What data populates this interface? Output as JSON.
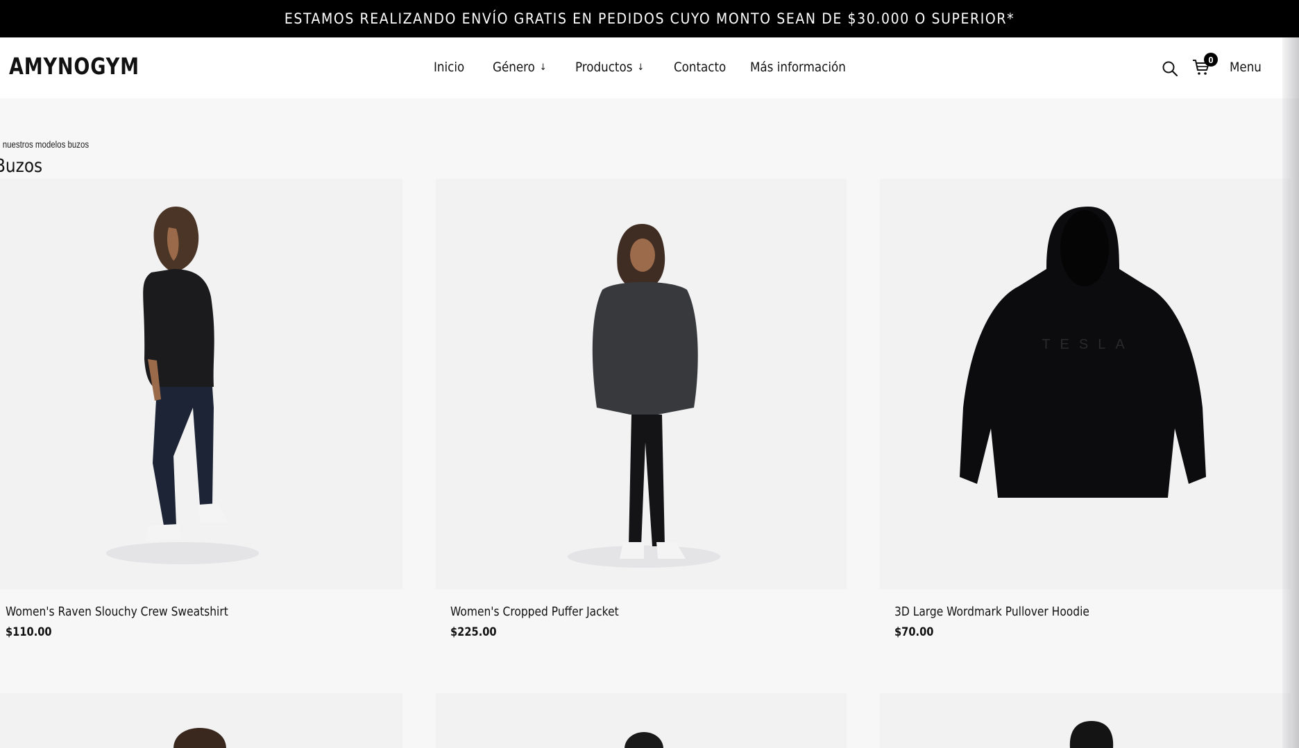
{
  "announcement": "ESTAMOS REALIZANDO ENVÍO GRATIS EN PEDIDOS CUYO MONTO SEAN DE $30.000 O SUPERIOR*",
  "brand": {
    "logo": "AMYNOGYM"
  },
  "nav": [
    {
      "label": "Inicio",
      "has_dropdown": false
    },
    {
      "label": "Género",
      "has_dropdown": true
    },
    {
      "label": "Productos",
      "has_dropdown": true
    },
    {
      "label": "Contacto",
      "has_dropdown": false
    },
    {
      "label": "Más información",
      "has_dropdown": false
    }
  ],
  "header_actions": {
    "search_icon": "search-icon",
    "cart_icon": "cart-icon",
    "cart_count": "0",
    "menu_label": "Menu"
  },
  "section": {
    "subtitle": "das nuestros modelos buzos",
    "title": "Buzos"
  },
  "products": [
    {
      "name": "Women's Raven Slouchy Crew Sweatshirt",
      "price": "$110.00"
    },
    {
      "name": "Women's Cropped Puffer Jacket",
      "price": "$225.00"
    },
    {
      "name": "3D Large Wordmark Pullover Hoodie",
      "price": "$70.00"
    }
  ],
  "hoodie_print": "TESLA",
  "colors": {
    "announcement_bg": "#000000",
    "page_bg": "#f7f7f8",
    "card_bg": "#f2f2f3"
  }
}
